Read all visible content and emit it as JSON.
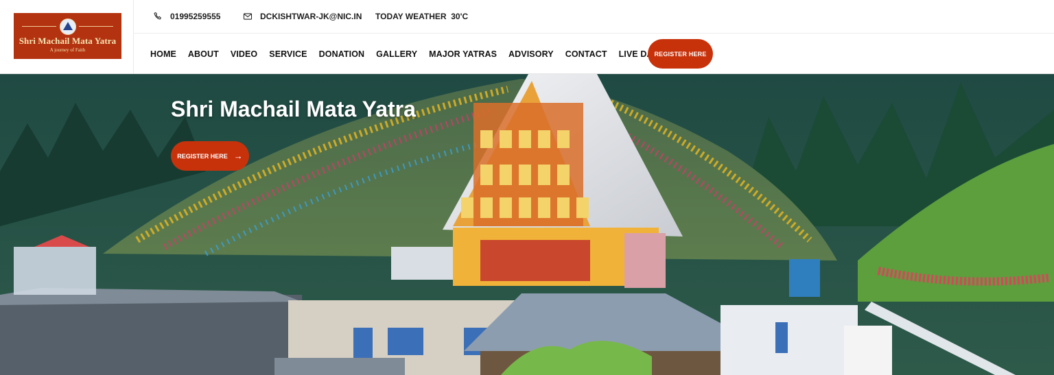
{
  "brand": {
    "logo_title": "Shri Machail Mata Yatra",
    "logo_tagline": "A journey of Faith",
    "logo_bg": "#b3320f"
  },
  "topbar": {
    "phone": "01995259555",
    "email": "DCKISHTWAR-JK@NIC.IN",
    "weather": "TODAY WEATHER  30'C",
    "phone_icon": "phone-icon",
    "email_icon": "mail-icon"
  },
  "nav": {
    "items": [
      "HOME",
      "ABOUT",
      "VIDEO",
      "SERVICE",
      "DONATION",
      "GALLERY",
      "MAJOR YATRAS",
      "ADVISORY",
      "CONTACT",
      "LIVE DARSHAN"
    ],
    "register_label": "REGISTER HERE"
  },
  "hero": {
    "title": "Shri Machail Mata Yatra",
    "button_label": "REGISTER HERE",
    "button_icon": "arrow-right-icon"
  },
  "colors": {
    "accent": "#c8320b"
  }
}
